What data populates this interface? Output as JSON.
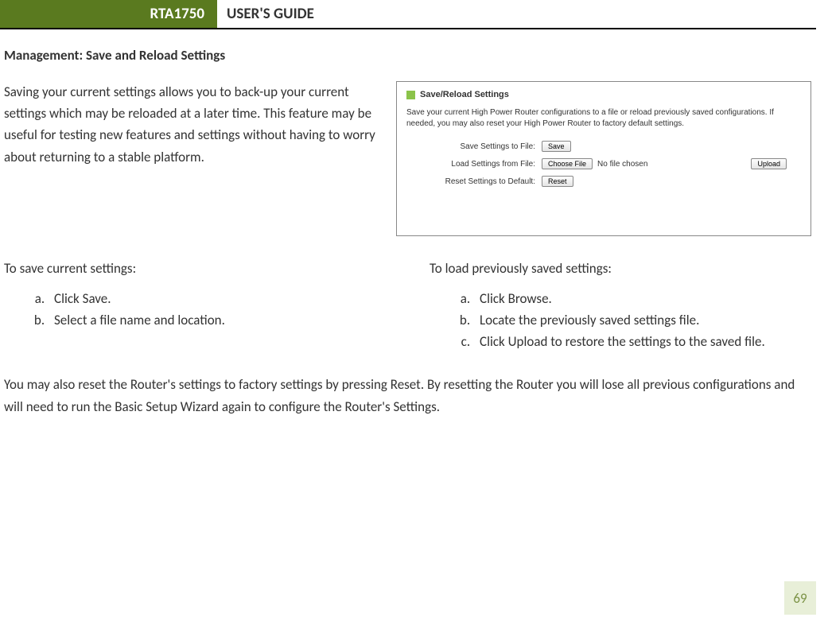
{
  "header": {
    "model": "RTA1750",
    "title": "USER'S GUIDE"
  },
  "section_title": "Management: Save and Reload Settings",
  "intro": "Saving your current settings allows you to back-up your current settings which may be reloaded at a later time.  This feature may be useful for testing new features and settings without having to worry about returning to a stable platform.",
  "screenshot": {
    "title": "Save/Reload Settings",
    "description": "Save your current High Power Router configurations to a file or reload previously saved configurations. If needed, you may also reset your High Power Router to factory default settings.",
    "rows": {
      "save": {
        "label": "Save Settings to File:",
        "btn": "Save"
      },
      "load": {
        "label": "Load Settings from File:",
        "choose_btn": "Choose File",
        "file_text": "No file chosen",
        "upload_btn": "Upload"
      },
      "reset": {
        "label": "Reset Settings to Default:",
        "btn": "Reset"
      }
    }
  },
  "save_section": {
    "heading": "To save current settings:",
    "items": [
      "Click Save.",
      "Select a file name and location."
    ]
  },
  "load_section": {
    "heading": "To load previously saved settings:",
    "items": [
      "Click Browse.",
      "Locate the previously saved settings file.",
      "Click Upload to restore the settings to the saved file."
    ]
  },
  "footer": "You may also reset the Router's settings to factory settings by pressing Reset.  By resetting the Router you will lose all previous configurations and will need to run the Basic Setup Wizard again to configure the Router's Settings.",
  "page_number": "69"
}
